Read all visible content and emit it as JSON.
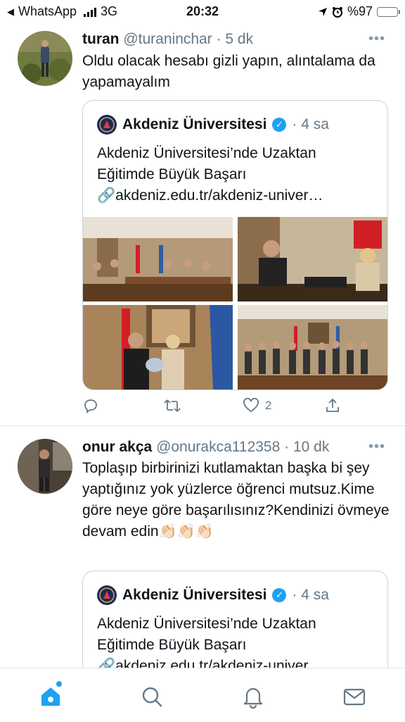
{
  "status_bar": {
    "back_app": "WhatsApp",
    "network": "3G",
    "time": "20:32",
    "battery_percent": "%97",
    "battery_level": 0.97
  },
  "tweets": [
    {
      "name": "turan",
      "handle": "@turaninchar",
      "time": "· 5 dk",
      "text": "Oldu olacak hesabı gizli yapın, alıntalama da yapamayalım",
      "quote": {
        "name": "Akdeniz Üniversitesi",
        "time": "· 4 sa",
        "text_line1": "Akdeniz Üniversitesi’nde Uzaktan",
        "text_line2": "Eğitimde Büyük Başarı",
        "link": "akdeniz.edu.tr/akdeniz-univer…"
      },
      "like_count": "2"
    },
    {
      "name": "onur akça",
      "handle": "@onurakca112358",
      "time": "· 10 dk",
      "text": "Toplaşıp birbirinizi kutlamaktan başka bi şey yaptığınız yok yüzlerce öğrenci mutsuz.Kime göre neye göre başarılısınız?Kendinizi övmeye devam edin👏🏻👏🏻👏🏻",
      "quote": {
        "name": "Akdeniz Üniversitesi",
        "time": "· 4 sa",
        "text_line1": "Akdeniz Üniversitesi’nde Uzaktan",
        "text_line2": "Eğitimde Büyük Başarı",
        "link": "akdeniz.edu.tr/akdeniz-univer…"
      }
    }
  ],
  "icons": {
    "reply": "reply-icon",
    "retweet": "retweet-icon",
    "like": "heart-icon",
    "share": "share-icon",
    "more": "more-icon",
    "verified": "verified-badge-icon"
  },
  "tab_bar": [
    "home-icon",
    "search-icon",
    "notifications-icon",
    "messages-icon"
  ],
  "colors": {
    "accent": "#1da1f2",
    "text": "#0f1419",
    "secondary": "#657786",
    "border": "#e1e8ed",
    "battery": "#f5c518"
  }
}
